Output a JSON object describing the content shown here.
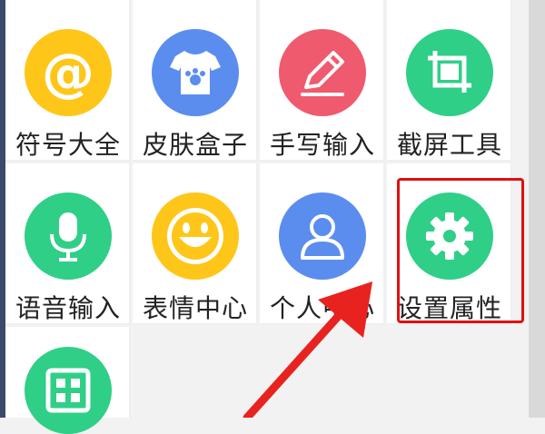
{
  "tiles": [
    {
      "label": "符号大全",
      "icon": "at-sign-icon",
      "color": "#ffc61a",
      "text": "@"
    },
    {
      "label": "皮肤盒子",
      "icon": "tshirt-icon",
      "color": "#5b8def"
    },
    {
      "label": "手写输入",
      "icon": "pencil-icon",
      "color": "#f05a6e"
    },
    {
      "label": "截屏工具",
      "icon": "crop-icon",
      "color": "#2fcf87"
    },
    {
      "label": "语音输入",
      "icon": "microphone-icon",
      "color": "#2fcf87"
    },
    {
      "label": "表情中心",
      "icon": "smiley-icon",
      "color": "#ffc61a"
    },
    {
      "label": "个人中心",
      "icon": "user-icon",
      "color": "#5b8def"
    },
    {
      "label": "设置属性",
      "icon": "gear-icon",
      "color": "#2fcf87"
    },
    {
      "label": "",
      "icon": "grid-icon",
      "color": "#2fcf87"
    }
  ],
  "highlight": {
    "tile": "设置属性",
    "color": "#e01010"
  }
}
